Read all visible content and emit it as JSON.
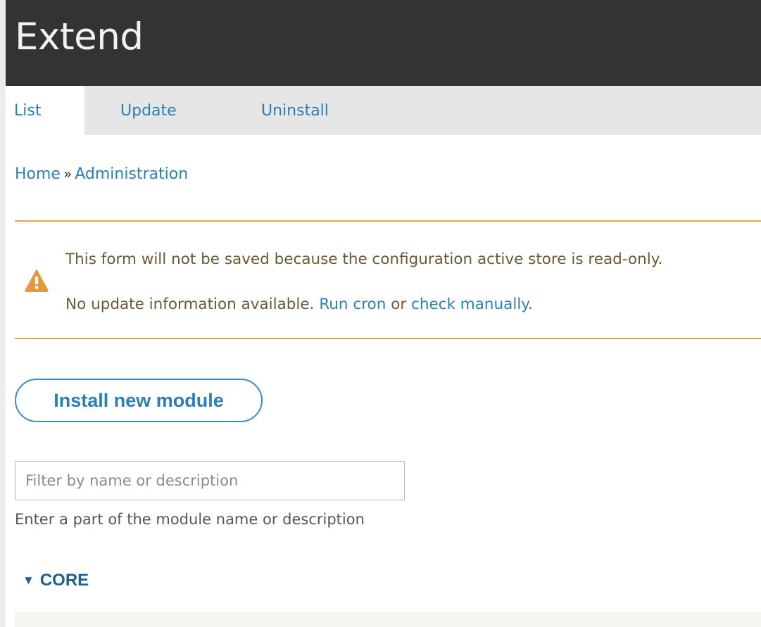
{
  "header": {
    "title": "Extend"
  },
  "tabs": [
    {
      "label": "List",
      "active": true
    },
    {
      "label": "Update",
      "active": false
    },
    {
      "label": "Uninstall",
      "active": false
    }
  ],
  "breadcrumb": {
    "items": [
      "Home",
      "Administration"
    ],
    "separator": "»"
  },
  "messages": {
    "icon": "warning-icon",
    "line1": "This form will not be saved because the configuration active store is read-only.",
    "line2_prefix": "No update information available.",
    "run_cron_link": "Run cron",
    "line2_middle": "or",
    "check_manually_link": "check manually",
    "line2_suffix": "."
  },
  "install_button": {
    "label": "Install new module"
  },
  "filter": {
    "placeholder": "Filter by name or description",
    "value": "",
    "help": "Enter a part of the module name or description"
  },
  "package_group": {
    "label": "CORE",
    "expanded": true
  },
  "colors": {
    "header_bg": "#333333",
    "link": "#2a7fb6",
    "warning_border": "#e8a54b",
    "warning_icon": "#e29a3b",
    "tabs_bg": "#e6e6e6"
  }
}
